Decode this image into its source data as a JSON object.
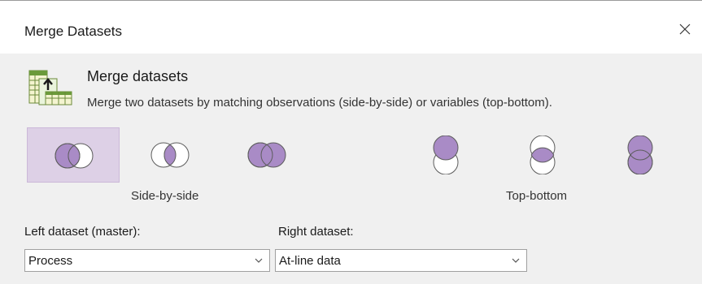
{
  "window": {
    "title": "Merge Datasets",
    "close_icon": "close-icon"
  },
  "header": {
    "icon": "merge-datasets-icon",
    "title": "Merge datasets",
    "description": "Merge two datasets by matching observations (side-by-side) or variables (top-bottom)."
  },
  "modes": [
    {
      "name": "side-by-side-left-join",
      "group": "Side-by-side",
      "selected": true
    },
    {
      "name": "side-by-side-inner-join",
      "group": "Side-by-side",
      "selected": false
    },
    {
      "name": "side-by-side-full-join",
      "group": "Side-by-side",
      "selected": false
    },
    {
      "name": "top-bottom-top-join",
      "group": "Top-bottom",
      "selected": false
    },
    {
      "name": "top-bottom-inner-join",
      "group": "Top-bottom",
      "selected": false
    },
    {
      "name": "top-bottom-full-join",
      "group": "Top-bottom",
      "selected": false
    }
  ],
  "groups": {
    "side_by_side": "Side-by-side",
    "top_bottom": "Top-bottom"
  },
  "left_dataset": {
    "label": "Left dataset (master):",
    "value": "Process"
  },
  "right_dataset": {
    "label": "Right dataset:",
    "value": "At-line data"
  },
  "colors": {
    "venn_fill": "#a98bc6",
    "selected_bg": "#ddd0e6",
    "dialog_bg": "#f0f0f0"
  }
}
